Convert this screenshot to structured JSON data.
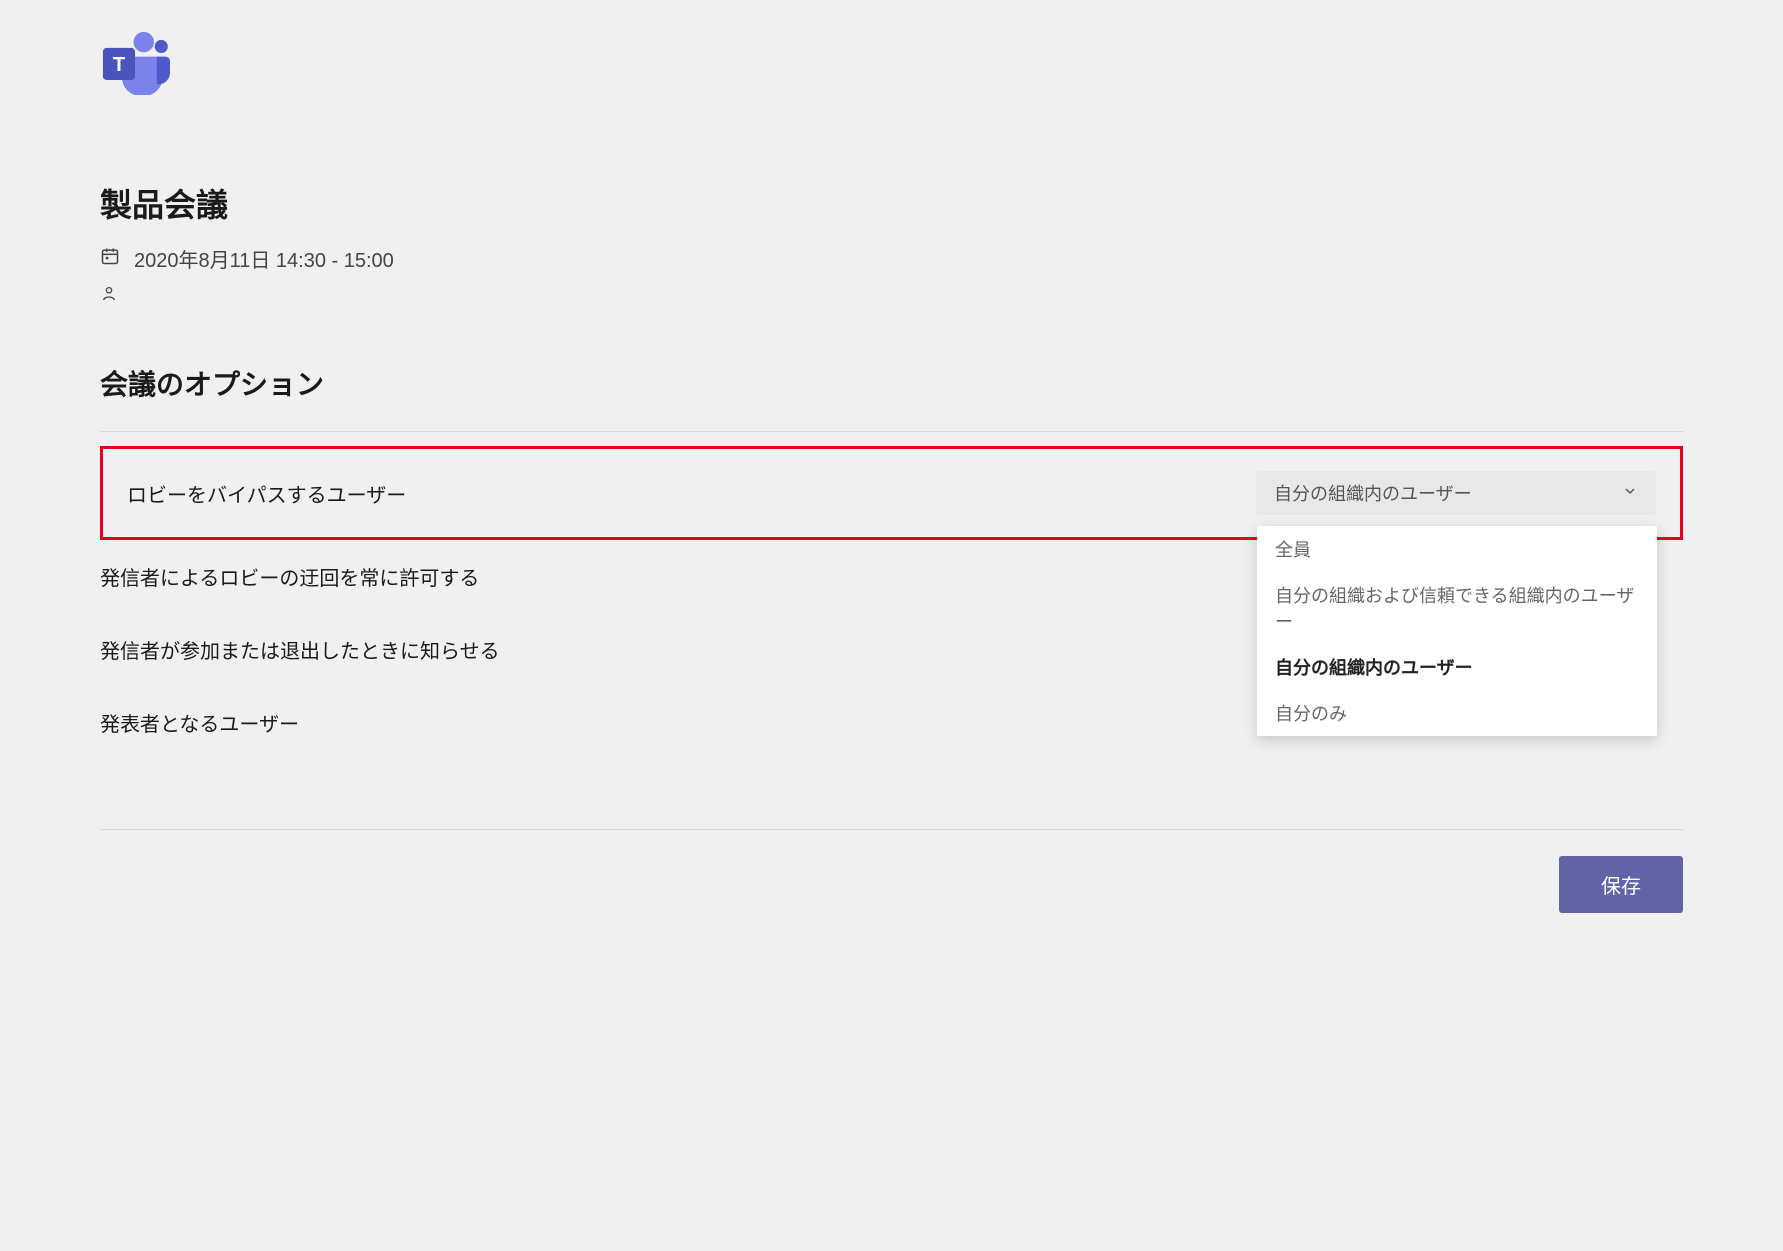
{
  "meeting": {
    "title": "製品会議",
    "datetime": "2020年8月11日 14:30 - 15:00"
  },
  "section": {
    "title": "会議のオプション"
  },
  "options": {
    "lobby_bypass": {
      "label": "ロビーをバイパスするユーザー",
      "selected": "自分の組織内のユーザー",
      "choices": {
        "0": "全員",
        "1": "自分の組織および信頼できる組織内のユーザー",
        "2": "自分の組織内のユーザー",
        "3": "自分のみ"
      }
    },
    "caller_bypass": {
      "label": "発信者によるロビーの迂回を常に許可する"
    },
    "announce": {
      "label": "発信者が参加または退出したときに知らせる"
    },
    "presenter": {
      "label": "発表者となるユーザー"
    }
  },
  "buttons": {
    "save": "保存"
  }
}
